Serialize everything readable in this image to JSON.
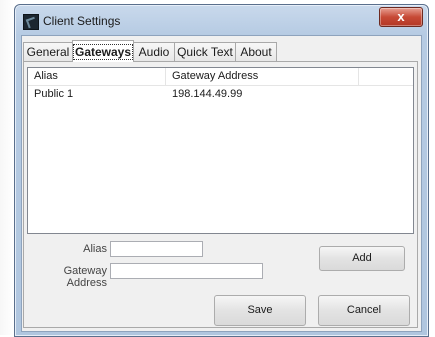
{
  "window": {
    "title": "Client Settings",
    "close_symbol": "x"
  },
  "tabs": [
    {
      "label": "General",
      "active": false
    },
    {
      "label": "Gateways",
      "active": true
    },
    {
      "label": "Audio",
      "active": false
    },
    {
      "label": "Quick Text",
      "active": false
    },
    {
      "label": "About",
      "active": false
    }
  ],
  "gateways": {
    "columns": [
      "Alias",
      "Gateway Address"
    ],
    "rows": [
      {
        "alias": "Public 1",
        "address": "198.144.49.99"
      }
    ]
  },
  "form": {
    "alias_label": "Alias",
    "alias_value": "",
    "address_label": "Gateway Address",
    "address_value": "",
    "add_label": "Add"
  },
  "footer": {
    "save_label": "Save",
    "cancel_label": "Cancel"
  },
  "icons": [
    "app-icon",
    "close-icon"
  ]
}
